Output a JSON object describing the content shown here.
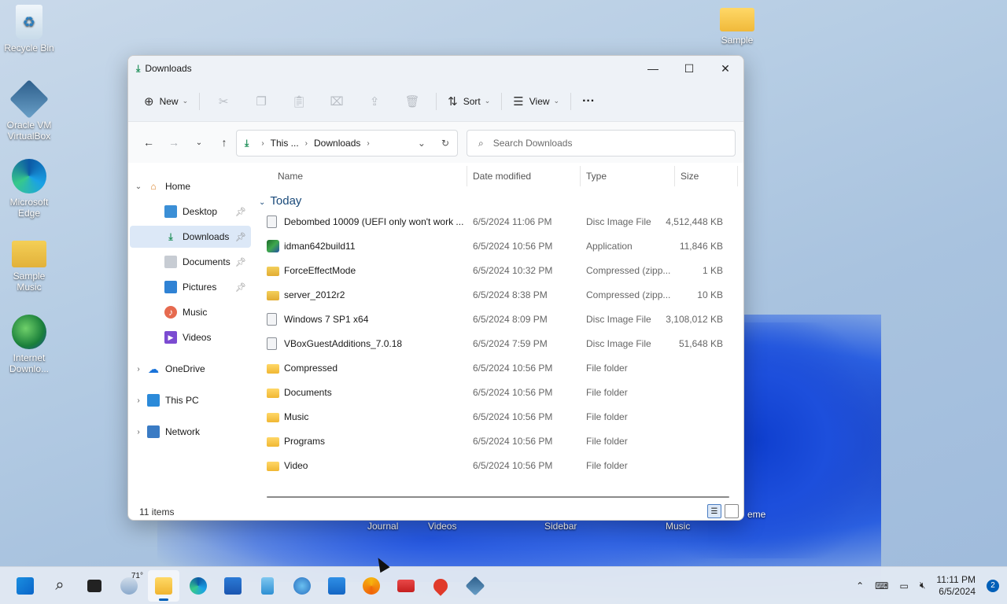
{
  "desktop": {
    "icons": [
      {
        "label": "Recycle Bin"
      },
      {
        "label": "Oracle VM VirtualBox"
      },
      {
        "label": "Microsoft Edge"
      },
      {
        "label": "Sample Music"
      },
      {
        "label": "Internet Downlo..."
      },
      {
        "label": "Sample"
      }
    ],
    "partial_labels": [
      "Journal",
      "Videos",
      "Sidebar",
      "Music",
      "eme"
    ]
  },
  "window": {
    "title": "Downloads",
    "controls": {
      "minimize": "—",
      "maximize": "☐",
      "close": "✕"
    },
    "cmdbar": {
      "new_label": "New",
      "sort_label": "Sort",
      "view_label": "View",
      "more_label": "···"
    },
    "address": {
      "crumb1": "This ...",
      "crumb2": "Downloads"
    },
    "search": {
      "placeholder": "Search Downloads"
    },
    "nav": [
      {
        "label": "Home"
      },
      {
        "label": "Desktop"
      },
      {
        "label": "Downloads"
      },
      {
        "label": "Documents"
      },
      {
        "label": "Pictures"
      },
      {
        "label": "Music"
      },
      {
        "label": "Videos"
      },
      {
        "label": "OneDrive"
      },
      {
        "label": "This PC"
      },
      {
        "label": "Network"
      }
    ],
    "columns": {
      "name": "Name",
      "date": "Date modified",
      "type": "Type",
      "size": "Size"
    },
    "group": "Today",
    "files": [
      {
        "name": "Debombed 10009 (UEFI only won't work ...",
        "date": "6/5/2024 11:06 PM",
        "type": "Disc Image File",
        "size": "4,512,448 KB",
        "icon": "disc-icon"
      },
      {
        "name": "idman642build11",
        "date": "6/5/2024 10:56 PM",
        "type": "Application",
        "size": "11,846 KB",
        "icon": "app-icon"
      },
      {
        "name": "ForceEffectMode",
        "date": "6/5/2024 10:32 PM",
        "type": "Compressed (zipp...",
        "size": "1 KB",
        "icon": "zip-icon"
      },
      {
        "name": "server_2012r2",
        "date": "6/5/2024 8:38 PM",
        "type": "Compressed (zipp...",
        "size": "10 KB",
        "icon": "zip-icon"
      },
      {
        "name": "Windows 7 SP1 x64",
        "date": "6/5/2024 8:09 PM",
        "type": "Disc Image File",
        "size": "3,108,012 KB",
        "icon": "disc-icon"
      },
      {
        "name": "VBoxGuestAdditions_7.0.18",
        "date": "6/5/2024 7:59 PM",
        "type": "Disc Image File",
        "size": "51,648 KB",
        "icon": "disc-icon"
      },
      {
        "name": "Compressed",
        "date": "6/5/2024 10:56 PM",
        "type": "File folder",
        "size": "",
        "icon": "folder-icon"
      },
      {
        "name": "Documents",
        "date": "6/5/2024 10:56 PM",
        "type": "File folder",
        "size": "",
        "icon": "folder-icon"
      },
      {
        "name": "Music",
        "date": "6/5/2024 10:56 PM",
        "type": "File folder",
        "size": "",
        "icon": "folder-icon"
      },
      {
        "name": "Programs",
        "date": "6/5/2024 10:56 PM",
        "type": "File folder",
        "size": "",
        "icon": "folder-icon"
      },
      {
        "name": "Video",
        "date": "6/5/2024 10:56 PM",
        "type": "File folder",
        "size": "",
        "icon": "folder-icon"
      }
    ],
    "status": "11 items"
  },
  "taskbar": {
    "weather": "71°",
    "time": "11:11 PM",
    "date": "6/5/2024",
    "notifications": "2",
    "accent": "#005fb8"
  }
}
